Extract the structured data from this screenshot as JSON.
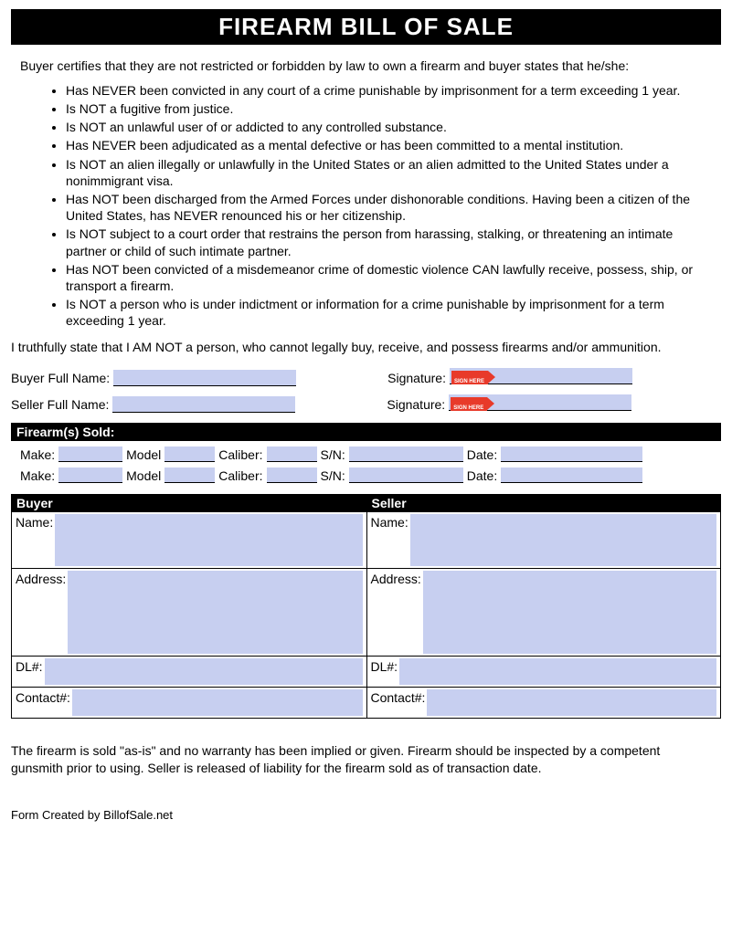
{
  "title": "FIREARM BILL OF SALE",
  "intro": "Buyer certifies that they are not restricted or forbidden by law to own a firearm and buyer states that he/she:",
  "certifications": [
    "Has NEVER been convicted in any court of a crime punishable by imprisonment for a term exceeding 1 year.",
    "Is NOT a fugitive from justice.",
    "Is NOT an unlawful user of or addicted to any controlled substance.",
    "Has NEVER been adjudicated as a mental defective or has been committed to a mental institution.",
    "Is NOT an alien illegally or unlawfully in the United States or an alien admitted to the United States under a nonimmigrant visa.",
    "Has NOT been discharged from the Armed Forces under dishonorable conditions. Having been a citizen of the United States, has NEVER renounced his or her citizenship.",
    "Is NOT subject to a court order that restrains the person from harassing, stalking, or threatening an intimate partner or child of such intimate partner.",
    "Has NOT been convicted of a misdemeanor crime of domestic violence CAN lawfully receive, possess, ship, or transport a firearm.",
    "Is NOT a person who is under indictment or information for a crime punishable by imprisonment for a term exceeding 1 year."
  ],
  "statement": "I truthfully state that I AM NOT a person, who cannot legally buy, receive, and possess firearms and/or ammunition.",
  "labels": {
    "buyer_full_name": "Buyer Full Name:",
    "seller_full_name": "Seller Full Name:",
    "signature": "Signature:",
    "firearms_sold": "Firearm(s) Sold:",
    "make": "Make:",
    "model": "Model",
    "caliber": "Caliber:",
    "sn": "S/N:",
    "date": "Date:",
    "buyer": "Buyer",
    "seller": "Seller",
    "name": "Name:",
    "address": "Address:",
    "dl": "DL#:",
    "contact": "Contact#:",
    "sign_here": "SIGN HERE"
  },
  "disclaimer": "The firearm is sold \"as-is\" and no warranty has been implied or given. Firearm should be inspected by a competent gunsmith prior to using.  Seller is released of liability for the firearm sold as of transaction date.",
  "footer": "Form Created by BillofSale.net"
}
